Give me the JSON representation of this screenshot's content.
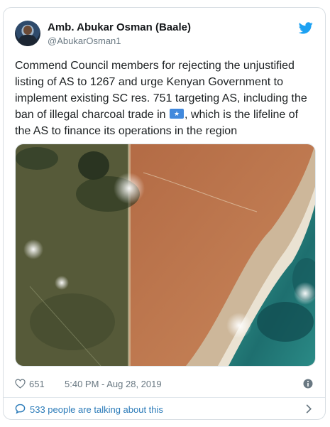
{
  "tweet": {
    "author_name": "Amb. Abukar Osman (Baale)",
    "author_handle": "@AbukarOsman1",
    "text_before_flag": "Commend Council members for rejecting the unjustified listing of AS to 1267 and urge Kenyan Government to implement existing SC res. 751 targeting AS, including the ban of illegal charcoal trade in",
    "flag_icon": "somalia-flag-emoji",
    "text_after_flag": ", which is the lifeline of the AS to finance its operations in the region",
    "likes": "651",
    "timestamp": "5:40 PM - Aug 28, 2019"
  },
  "footer": {
    "talking_label": "533 people are talking about this"
  },
  "icons": {
    "brand": "twitter-bird-icon",
    "like": "heart-icon",
    "info": "info-icon",
    "talk": "speech-bubble-icon",
    "next": "chevron-right-icon"
  },
  "colors": {
    "brand": "#1da1f2",
    "link": "#2b7bb9",
    "muted": "#697882",
    "text": "#1c2022"
  }
}
